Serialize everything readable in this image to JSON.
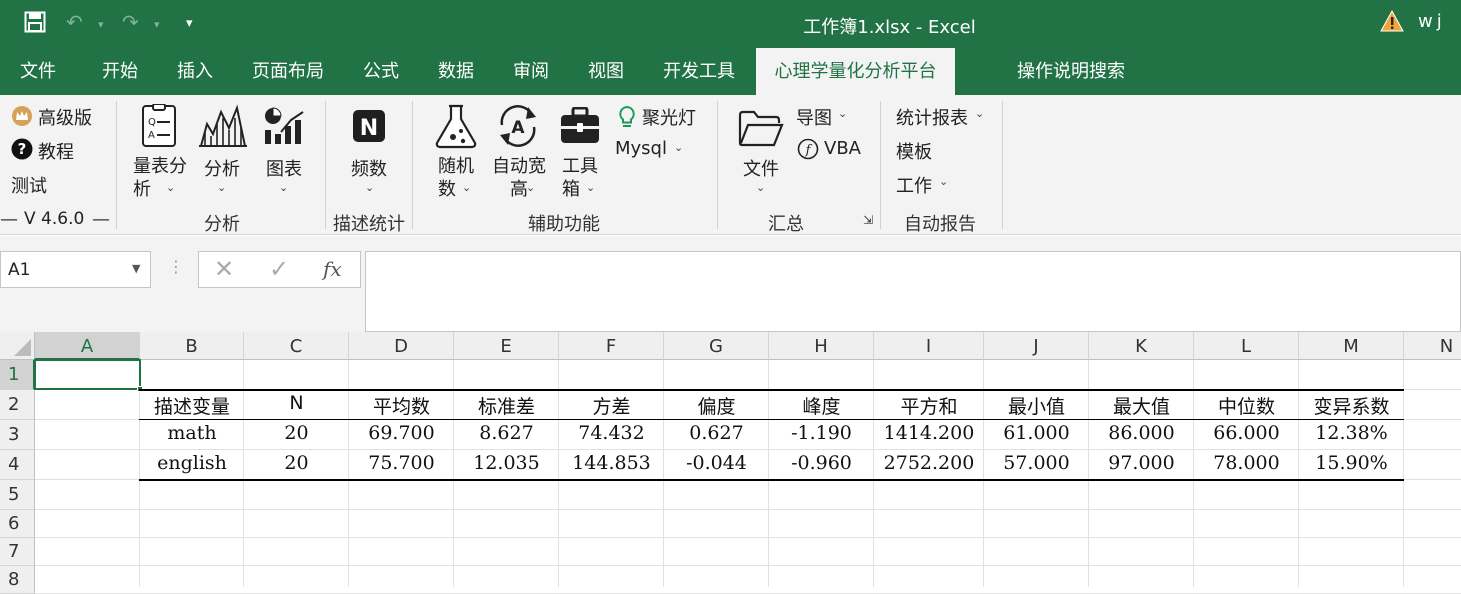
{
  "titlebar": {
    "title": "工作簿1.xlsx  -  Excel",
    "user": "wj"
  },
  "tabs": [
    "文件",
    "开始",
    "插入",
    "页面布局",
    "公式",
    "数据",
    "审阅",
    "视图",
    "开发工具",
    "心理学量化分析平台",
    "操作说明搜索"
  ],
  "ribbon": {
    "pro": "高级版",
    "tutorial": "教程",
    "test": "测试",
    "version": "V 4.6.0",
    "scale_analysis": "量表分析",
    "analysis": "分析",
    "chart": "图表",
    "group_analysis": "分析",
    "frequency": "频数",
    "group_desc": "描述统计",
    "random": "随机数",
    "autofit": "自动宽高",
    "toolbox": "工具箱",
    "spotlight": "聚光灯",
    "mysql": "Mysql",
    "group_aux": "辅助功能",
    "file": "文件",
    "export_chart": "导图",
    "vba": "VBA",
    "group_summary": "汇总",
    "stat_report": "统计报表",
    "template": "模板",
    "work": "工作",
    "group_auto": "自动报告"
  },
  "formula_bar": {
    "name_box": "A1",
    "fx": "fx",
    "formula": ""
  },
  "sheet": {
    "columns": [
      "A",
      "B",
      "C",
      "D",
      "E",
      "F",
      "G",
      "H",
      "I",
      "J",
      "K",
      "L",
      "M",
      "N"
    ],
    "rows": [
      "1",
      "2",
      "3",
      "4",
      "5",
      "6",
      "7",
      "8"
    ],
    "table_header": [
      "描述变量",
      "N",
      "平均数",
      "标准差",
      "方差",
      "偏度",
      "峰度",
      "平方和",
      "最小值",
      "最大值",
      "中位数",
      "变异系数"
    ],
    "table_rows": [
      [
        "math",
        "20",
        "69.700",
        "8.627",
        "74.432",
        "0.627",
        "-1.190",
        "1414.200",
        "61.000",
        "86.000",
        "66.000",
        "12.38%"
      ],
      [
        "english",
        "20",
        "75.700",
        "12.035",
        "144.853",
        "-0.044",
        "-0.960",
        "2752.200",
        "57.000",
        "97.000",
        "78.000",
        "15.90%"
      ]
    ]
  },
  "colors": {
    "accent": "#217346",
    "ribbon_bg": "#f3f3f3"
  }
}
